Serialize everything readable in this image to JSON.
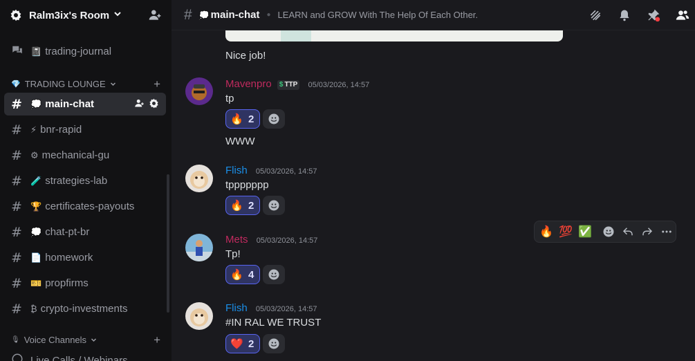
{
  "server": {
    "name": "Ralm3ix's Room",
    "top_channel": "trading-journal",
    "category_trading": "TRADING LOUNGE",
    "category_voice": "Voice Channels",
    "voice_channel": "Live Calls / Webinars"
  },
  "channels": [
    {
      "emoji": "💭",
      "name": "main-chat",
      "active": true
    },
    {
      "emoji": "⚡",
      "name": "bnr-rapid"
    },
    {
      "emoji": "⚙",
      "name": "mechanical-gu"
    },
    {
      "emoji": "🧪",
      "name": "strategies-lab"
    },
    {
      "emoji": "🏆",
      "name": "certificates-payouts"
    },
    {
      "emoji": "💭",
      "name": "chat-pt-br"
    },
    {
      "emoji": "📄",
      "name": "homework"
    },
    {
      "emoji": "🎫",
      "name": "propfirms"
    },
    {
      "emoji": "₿",
      "name": "crypto-investments"
    }
  ],
  "topbar": {
    "channel_emoji": "💭",
    "channel": "main-chat",
    "topic": "LEARN and GROW With The Help Of Each Other."
  },
  "messages": {
    "prev_text": "Nice job!",
    "m1": {
      "user": "Mavenpro",
      "badge": "TTP",
      "time": "05/03/2026, 14:57",
      "text": "tp",
      "react_emoji": "🔥",
      "react_count": "2",
      "followup": "WWW",
      "color": "#c02a5e"
    },
    "m2": {
      "user": "Flish",
      "time": "05/03/2026, 14:57",
      "text": "tppppppp",
      "react_emoji": "🔥",
      "react_count": "2",
      "color": "#1a8fe8"
    },
    "m3": {
      "user": "Mets",
      "time": "05/03/2026, 14:57",
      "text": "Tp!",
      "react_emoji": "🔥",
      "react_count": "4",
      "color": "#c02a5e"
    },
    "m4": {
      "user": "Flish",
      "time": "05/03/2026, 14:57",
      "text": "#IN RAL WE TRUST",
      "react_emoji": "❤️",
      "react_count": "2",
      "color": "#1a8fe8"
    }
  },
  "hover_bar": {
    "e1": "🔥",
    "e2": "💯",
    "e3": "✅"
  }
}
